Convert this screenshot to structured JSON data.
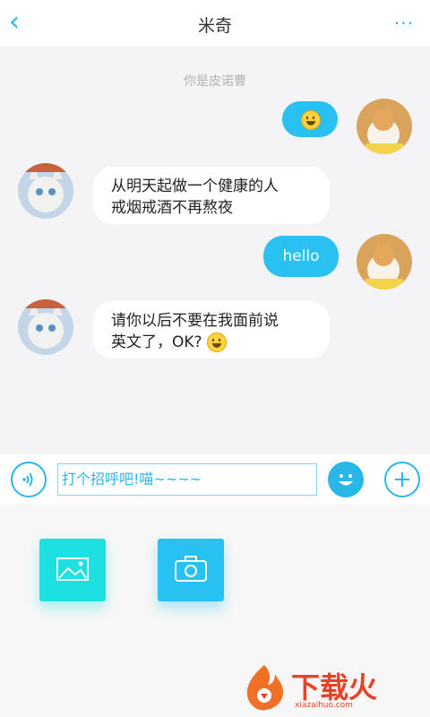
{
  "header": {
    "title": "米奇",
    "back_icon": "back-arrow-icon",
    "more_icon": "more-dots-icon"
  },
  "chat": {
    "hint": "你是皮诺曹",
    "messages": [
      {
        "side": "out",
        "text": ""
      },
      {
        "side": "in",
        "line1": "从明天起做一个健康的人",
        "line2": "戒烟戒酒不再熬夜"
      },
      {
        "side": "out",
        "text": "hello"
      },
      {
        "side": "in",
        "line1": "请你以后不要在我面前说",
        "line2": "英文了，OK?"
      }
    ]
  },
  "input": {
    "value": "打个招呼吧!喵~~~~",
    "voice_icon": "voice-icon",
    "emoji_icon": "emoji-icon",
    "add_icon": "plus-icon"
  },
  "panel": {
    "image_icon": "image-icon",
    "camera_icon": "camera-icon"
  },
  "watermark": {
    "text": "下载火",
    "url": "xiazaihuo.com"
  },
  "colors": {
    "accent": "#29b6e8",
    "bubble_out": "#29c0f2",
    "panel_tile": "#1ee0e0",
    "watermark": "#e84125"
  }
}
